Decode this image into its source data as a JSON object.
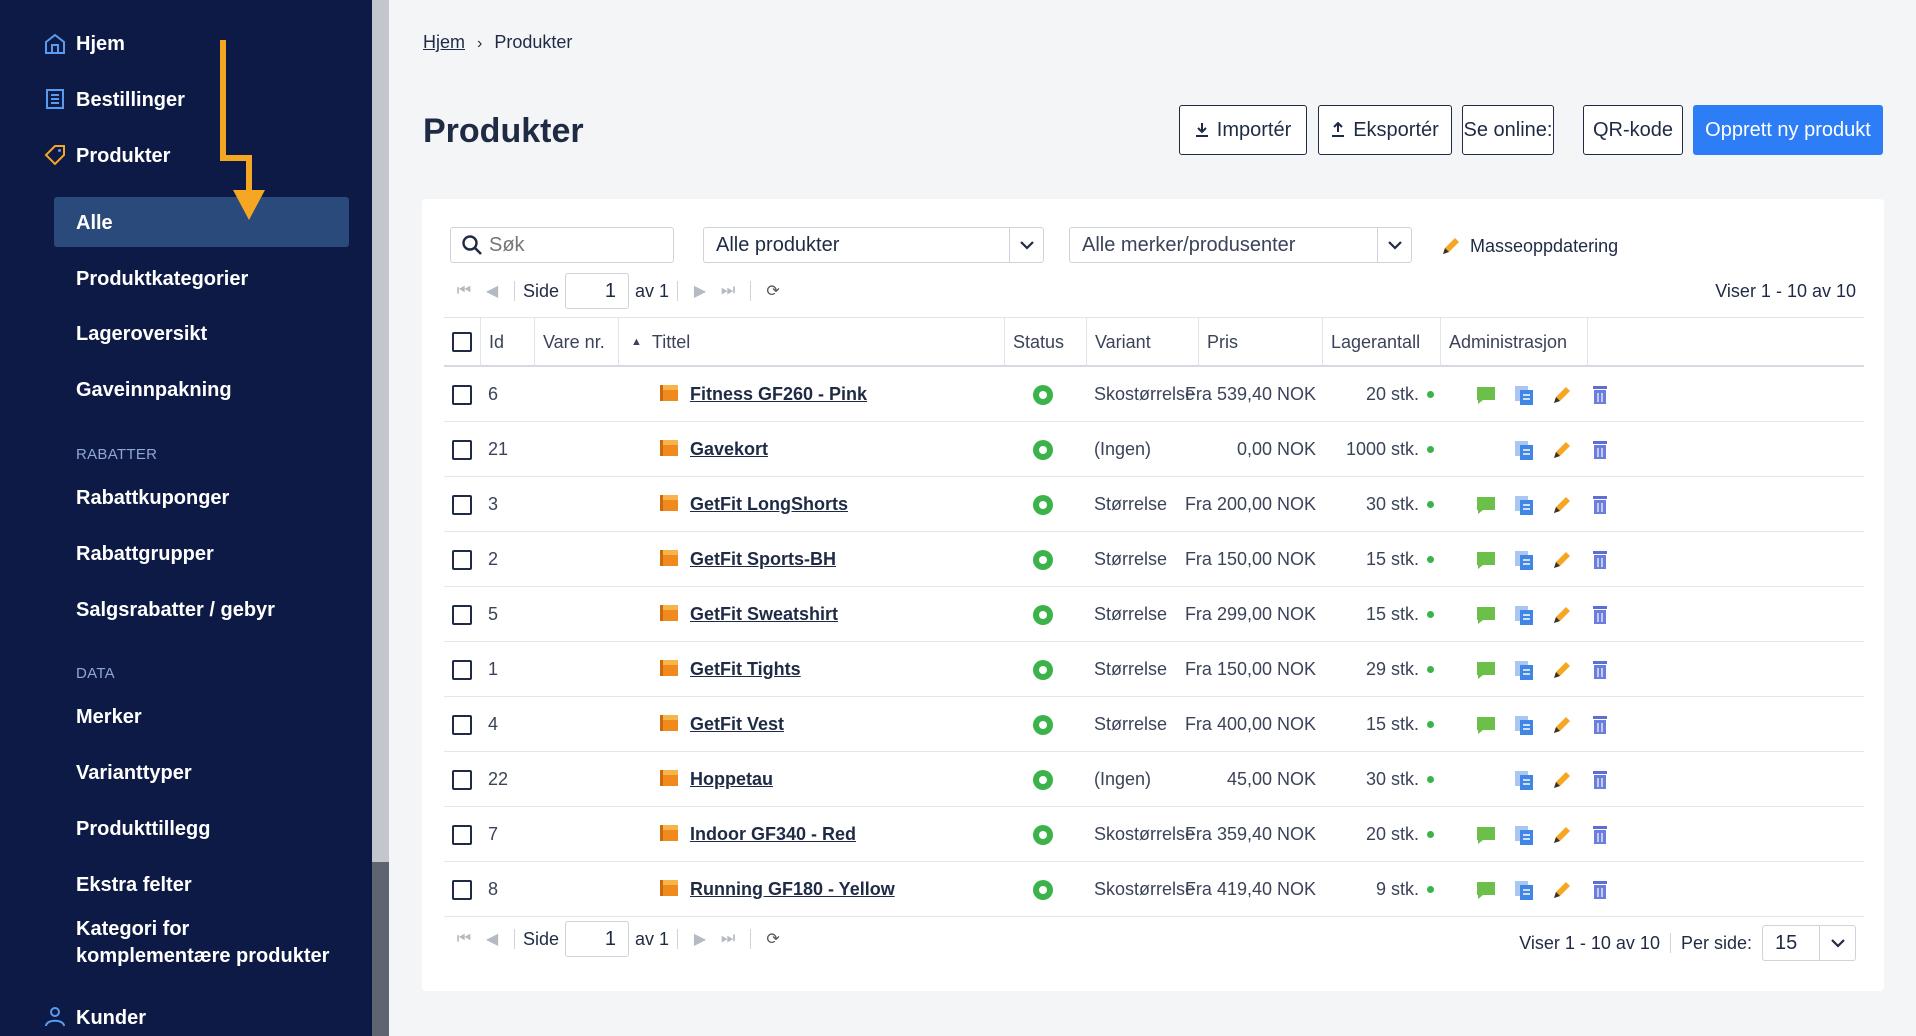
{
  "sidebar": {
    "items": [
      {
        "label": "Hjem",
        "icon": "home-icon"
      },
      {
        "label": "Bestillinger",
        "icon": "orders-icon"
      },
      {
        "label": "Produkter",
        "icon": "tag-icon"
      }
    ],
    "sub_items": [
      "Alle",
      "Produktkategorier",
      "Lageroversikt",
      "Gaveinnpakning"
    ],
    "section_discounts": "RABATTER",
    "discount_items": [
      "Rabattkuponger",
      "Rabattgrupper",
      "Salgsrabatter / gebyr"
    ],
    "section_data": "DATA",
    "data_items": [
      "Merker",
      "Varianttyper",
      "Produkttillegg",
      "Ekstra felter"
    ],
    "data_item_multiline": [
      "Kategori for",
      "komplementære produkter"
    ],
    "customers": "Kunder"
  },
  "breadcrumb": {
    "home": "Hjem",
    "separator": "›",
    "current": "Produkter"
  },
  "page_title": "Produkter",
  "toolbar": {
    "import": "Importér",
    "export": "Eksportér",
    "see_online": "Se online:",
    "qr": "QR-kode",
    "create": "Opprett ny produkt"
  },
  "filters": {
    "search_placeholder": "Søk",
    "products_select": "Alle produkter",
    "brands_select": "Alle merker/produsenter",
    "mass_update": "Masseoppdatering"
  },
  "pager": {
    "page_label": "Side",
    "page": "1",
    "of_label": "av 1",
    "showing": "Viser 1 - 10 av 10",
    "per_page_label": "Per side:",
    "per_page": "15"
  },
  "columns": [
    "Id",
    "Vare nr.",
    "Tittel",
    "Status",
    "Variant",
    "Pris",
    "Lagerantall",
    "Administrasjon"
  ],
  "rows": [
    {
      "id": "6",
      "title": "Fitness GF260 - Pink",
      "variant": "Skostørrelse",
      "price": "Fra 539,40 NOK",
      "stock": "20 stk.",
      "comment": true
    },
    {
      "id": "21",
      "title": "Gavekort",
      "variant": "(Ingen)",
      "price": "0,00 NOK",
      "stock": "1000 stk.",
      "comment": false
    },
    {
      "id": "3",
      "title": "GetFit LongShorts",
      "variant": "Størrelse",
      "price": "Fra 200,00 NOK",
      "stock": "30 stk.",
      "comment": true
    },
    {
      "id": "2",
      "title": "GetFit Sports-BH",
      "variant": "Størrelse",
      "price": "Fra 150,00 NOK",
      "stock": "15 stk.",
      "comment": true
    },
    {
      "id": "5",
      "title": "GetFit Sweatshirt",
      "variant": "Størrelse",
      "price": "Fra 299,00 NOK",
      "stock": "15 stk.",
      "comment": true
    },
    {
      "id": "1",
      "title": "GetFit Tights",
      "variant": "Størrelse",
      "price": "Fra 150,00 NOK",
      "stock": "29 stk.",
      "comment": true
    },
    {
      "id": "4",
      "title": "GetFit Vest",
      "variant": "Størrelse",
      "price": "Fra 400,00 NOK",
      "stock": "15 stk.",
      "comment": true
    },
    {
      "id": "22",
      "title": "Hoppetau",
      "variant": "(Ingen)",
      "price": "45,00 NOK",
      "stock": "30 stk.",
      "comment": false
    },
    {
      "id": "7",
      "title": "Indoor GF340 - Red",
      "variant": "Skostørrelse",
      "price": "Fra 359,40 NOK",
      "stock": "20 stk.",
      "comment": true
    },
    {
      "id": "8",
      "title": "Running GF180 - Yellow",
      "variant": "Skostørrelse",
      "price": "Fra 419,40 NOK",
      "stock": "9 stk.",
      "comment": true
    }
  ],
  "colors": {
    "sidebar": "#0d1a45",
    "active": "#2a4a7c",
    "primary": "#2d7df6",
    "status": "#3cb34a",
    "arrow": "#f5a623"
  }
}
